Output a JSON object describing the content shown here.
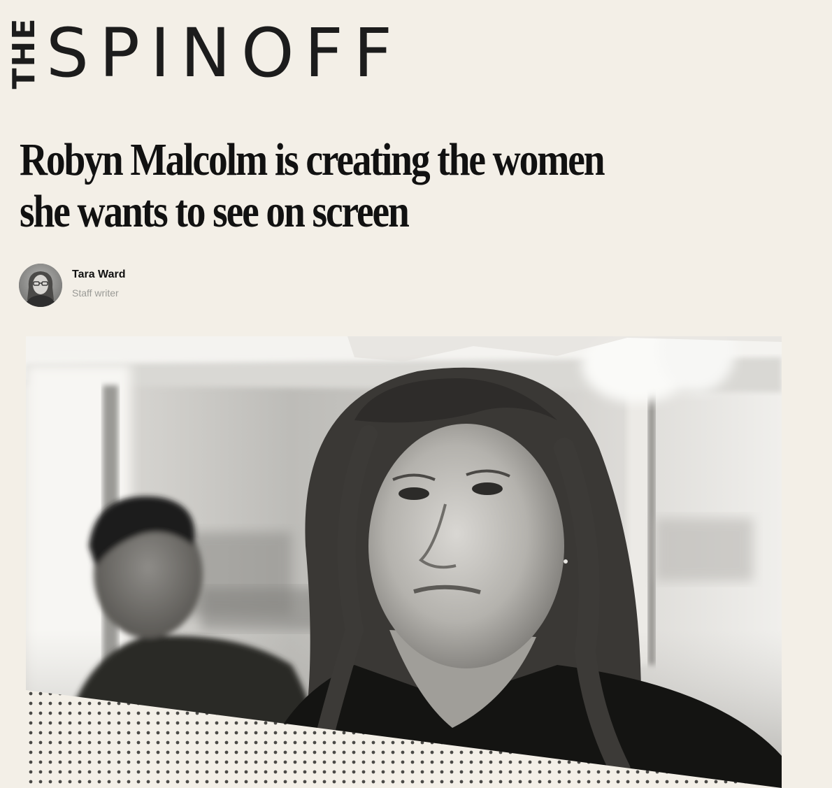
{
  "masthead": {
    "logo_prefix": "THE",
    "logo_text": "SPINOFF"
  },
  "article": {
    "headline": "Robyn Malcolm is creating the women she wants to see on screen",
    "author": {
      "name": "Tara Ward",
      "role": "Staff writer"
    }
  },
  "colors": {
    "background": "#f3efe7",
    "text": "#121212",
    "muted": "#9a9a96"
  }
}
